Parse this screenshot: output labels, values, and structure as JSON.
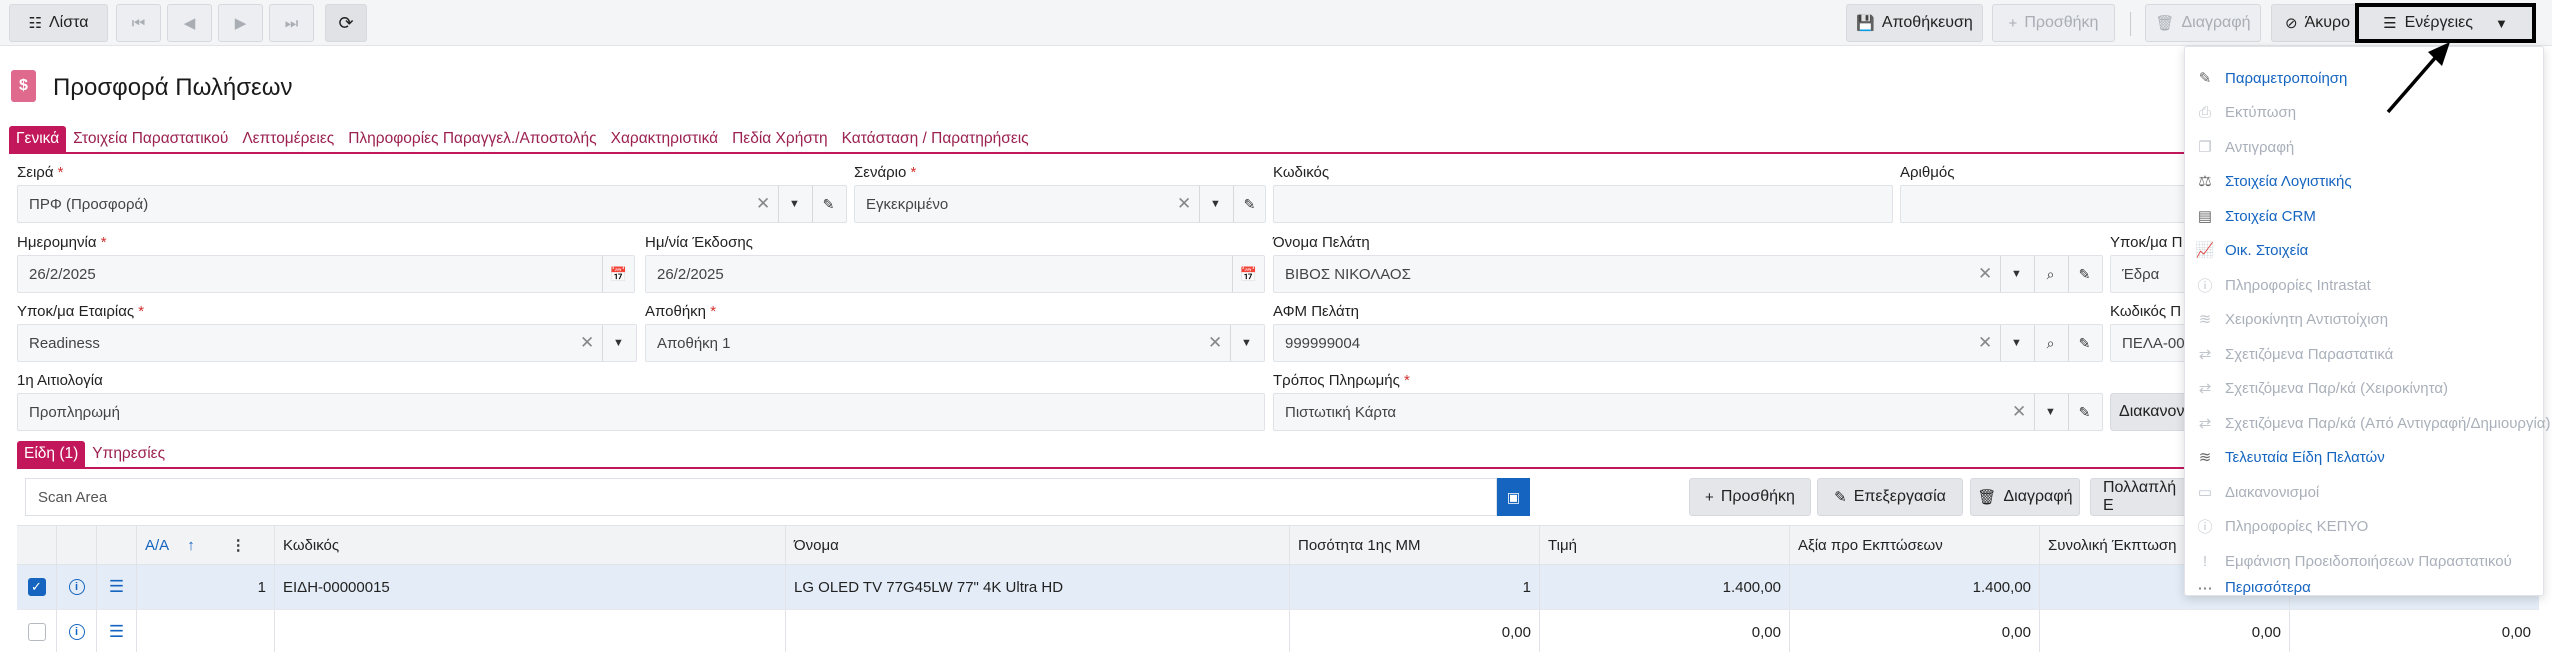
{
  "toolbar": {
    "list_label": "Λίστα",
    "save_label": "Αποθήκευση",
    "add_label": "Προσθήκη",
    "delete_label": "Διαγραφή",
    "cancel_label": "Άκυρο",
    "actions_label": "Ενέργειες"
  },
  "page": {
    "title": "Προσφορά Πωλήσεων",
    "icon_char": "$"
  },
  "tabs": [
    "Γενικά",
    "Στοιχεία Παραστατικού",
    "Λεπτομέρειες",
    "Πληροφορίες Παραγγελ./Αποστολής",
    "Χαρακτηριστικά",
    "Πεδία Χρήστη",
    "Κατάσταση / Παρατηρήσεις"
  ],
  "form": {
    "series": {
      "label": "Σειρά",
      "value": "ΠΡΦ (Προσφορά)"
    },
    "scenario": {
      "label": "Σενάριο",
      "value": "Εγκεκριμένο"
    },
    "code": {
      "label": "Κωδικός",
      "value": ""
    },
    "number": {
      "label": "Αριθμός",
      "value": ""
    },
    "date": {
      "label": "Ημερομηνία",
      "value": "26/2/2025"
    },
    "issue_date": {
      "label": "Ημ/νία Έκδοσης",
      "value": "26/2/2025"
    },
    "customer_name": {
      "label": "Όνομα Πελάτη",
      "value": "ΒΙΒΟΣ ΝΙΚΟΛΑΟΣ"
    },
    "customer_branch": {
      "label": "Υποκ/μα Π",
      "value": "Έδρα"
    },
    "company_branch": {
      "label": "Υποκ/μα Εταιρίας",
      "value": "Readiness"
    },
    "warehouse": {
      "label": "Αποθήκη",
      "value": "Αποθήκη 1"
    },
    "customer_vat": {
      "label": "ΑΦΜ Πελάτη",
      "value": "999999004"
    },
    "customer_code": {
      "label": "Κωδικός Π",
      "value": "ΠΕΛΑ-00"
    },
    "reason": {
      "label": "1η Αιτιολογία",
      "value": "Προπληρωμή"
    },
    "payment": {
      "label": "Τρόπος Πληρωμής",
      "value": "Πιστωτική Κάρτα"
    },
    "settings_btn": "Διακανον"
  },
  "line_tabs": [
    "Είδη (1)",
    "Υπηρεσίες"
  ],
  "lines": {
    "scan_placeholder": "Scan Area",
    "add_label": "Προσθήκη",
    "edit_label": "Επεξεργασία",
    "delete_label": "Διαγραφή",
    "multi_label": "Πολλαπλή Ε",
    "columns": [
      "Α/Α",
      "Κωδικός",
      "Όνομα",
      "Ποσότητα 1ης ΜΜ",
      "Τιμή",
      "Αξία προ Εκπτώσεων",
      "Συνολική Έκπτωση"
    ],
    "rows": [
      {
        "aa": "1",
        "code": "ΕΙΔΗ-00000015",
        "name": "LG OLED TV 77G45LW 77\" 4K Ultra HD",
        "qty": "1",
        "price": "1.400,00",
        "value": "1.400,00",
        "discount": ""
      },
      {
        "aa": "",
        "code": "",
        "name": "",
        "qty": "0,00",
        "price": "0,00",
        "value": "0,00",
        "discount": "0,00"
      }
    ],
    "extra_col_value": "0,00"
  },
  "menu": {
    "items": [
      {
        "label": "Παραμετροποίηση",
        "icon": "pencil-icon",
        "enabled": true
      },
      {
        "label": "Εκτύπωση",
        "icon": "printer-icon",
        "enabled": false
      },
      {
        "label": "Αντιγραφή",
        "icon": "copy-icon",
        "enabled": false
      },
      {
        "label": "Στοιχεία Λογιστικής",
        "icon": "balance-icon",
        "enabled": true
      },
      {
        "label": "Στοιχεία CRM",
        "icon": "crm-icon",
        "enabled": true
      },
      {
        "label": "Οικ. Στοιχεία",
        "icon": "chart-icon",
        "enabled": true
      },
      {
        "label": "Πληροφορίες Intrastat",
        "icon": "info-icon",
        "enabled": false
      },
      {
        "label": "Χειροκίνητη Αντιστοίχιση",
        "icon": "layers-icon",
        "enabled": false
      },
      {
        "label": "Σχετιζόμενα Παραστατικά",
        "icon": "swap-icon",
        "enabled": false
      },
      {
        "label": "Σχετιζόμενα Παρ/κά (Χειροκίνητα)",
        "icon": "swap-icon",
        "enabled": false
      },
      {
        "label": "Σχετιζόμενα Παρ/κά (Από Αντιγραφή/Δημιουργία)",
        "icon": "swap-icon",
        "enabled": false
      },
      {
        "label": "Τελευταία Είδη Πελατών",
        "icon": "layers-icon",
        "enabled": true
      },
      {
        "label": "Διακανονισμοί",
        "icon": "card-icon",
        "enabled": false
      },
      {
        "label": "Πληροφορίες ΚΕΠΥΟ",
        "icon": "info-icon",
        "enabled": false
      },
      {
        "label": "Εμφάνιση Προειδοποιήσεων Παραστατικού",
        "icon": "warning-icon",
        "enabled": false
      },
      {
        "label": "Περισσότερα",
        "icon": "dots-icon",
        "enabled": true
      }
    ]
  }
}
